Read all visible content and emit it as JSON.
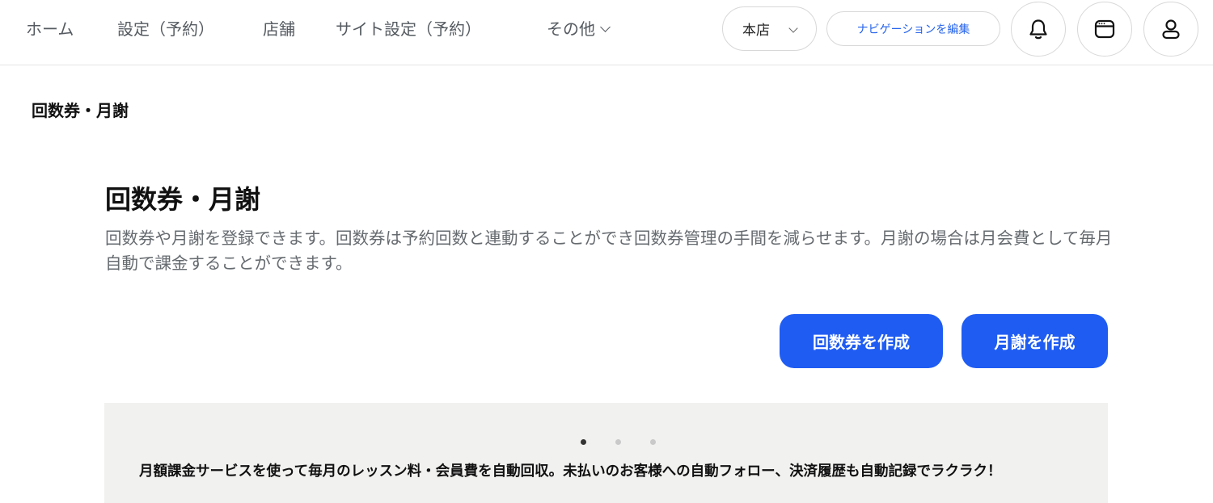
{
  "header": {
    "nav": [
      {
        "label": "ホーム"
      },
      {
        "label": "設定（予約）"
      },
      {
        "label": "店舗"
      },
      {
        "label": "サイト設定（予約）"
      },
      {
        "label": "その他"
      }
    ],
    "store_select": {
      "value": "本店"
    },
    "edit_nav_label": "ナビゲーションを編集",
    "icons": [
      "bell-icon",
      "browser-window-icon",
      "user-icon"
    ]
  },
  "breadcrumb": "回数券・月謝",
  "main": {
    "title": "回数券・月謝",
    "description": "回数券や月謝を登録できます。回数券は予約回数と連動することができ回数券管理の手間を減らせます。月謝の場合は月会費として毎月自動で課金することができます。",
    "buttons": {
      "create_ticket": "回数券を作成",
      "create_monthly": "月謝を作成"
    },
    "accent_color": "#1f5cf2"
  },
  "promo": {
    "slide_count": 3,
    "active_slide": 1,
    "text": "月額課金サービスを使って毎月のレッスン料・会員費を自動回収。未払いのお客様への自動フォロー、決済履歴も自動記録でラクラク！"
  }
}
